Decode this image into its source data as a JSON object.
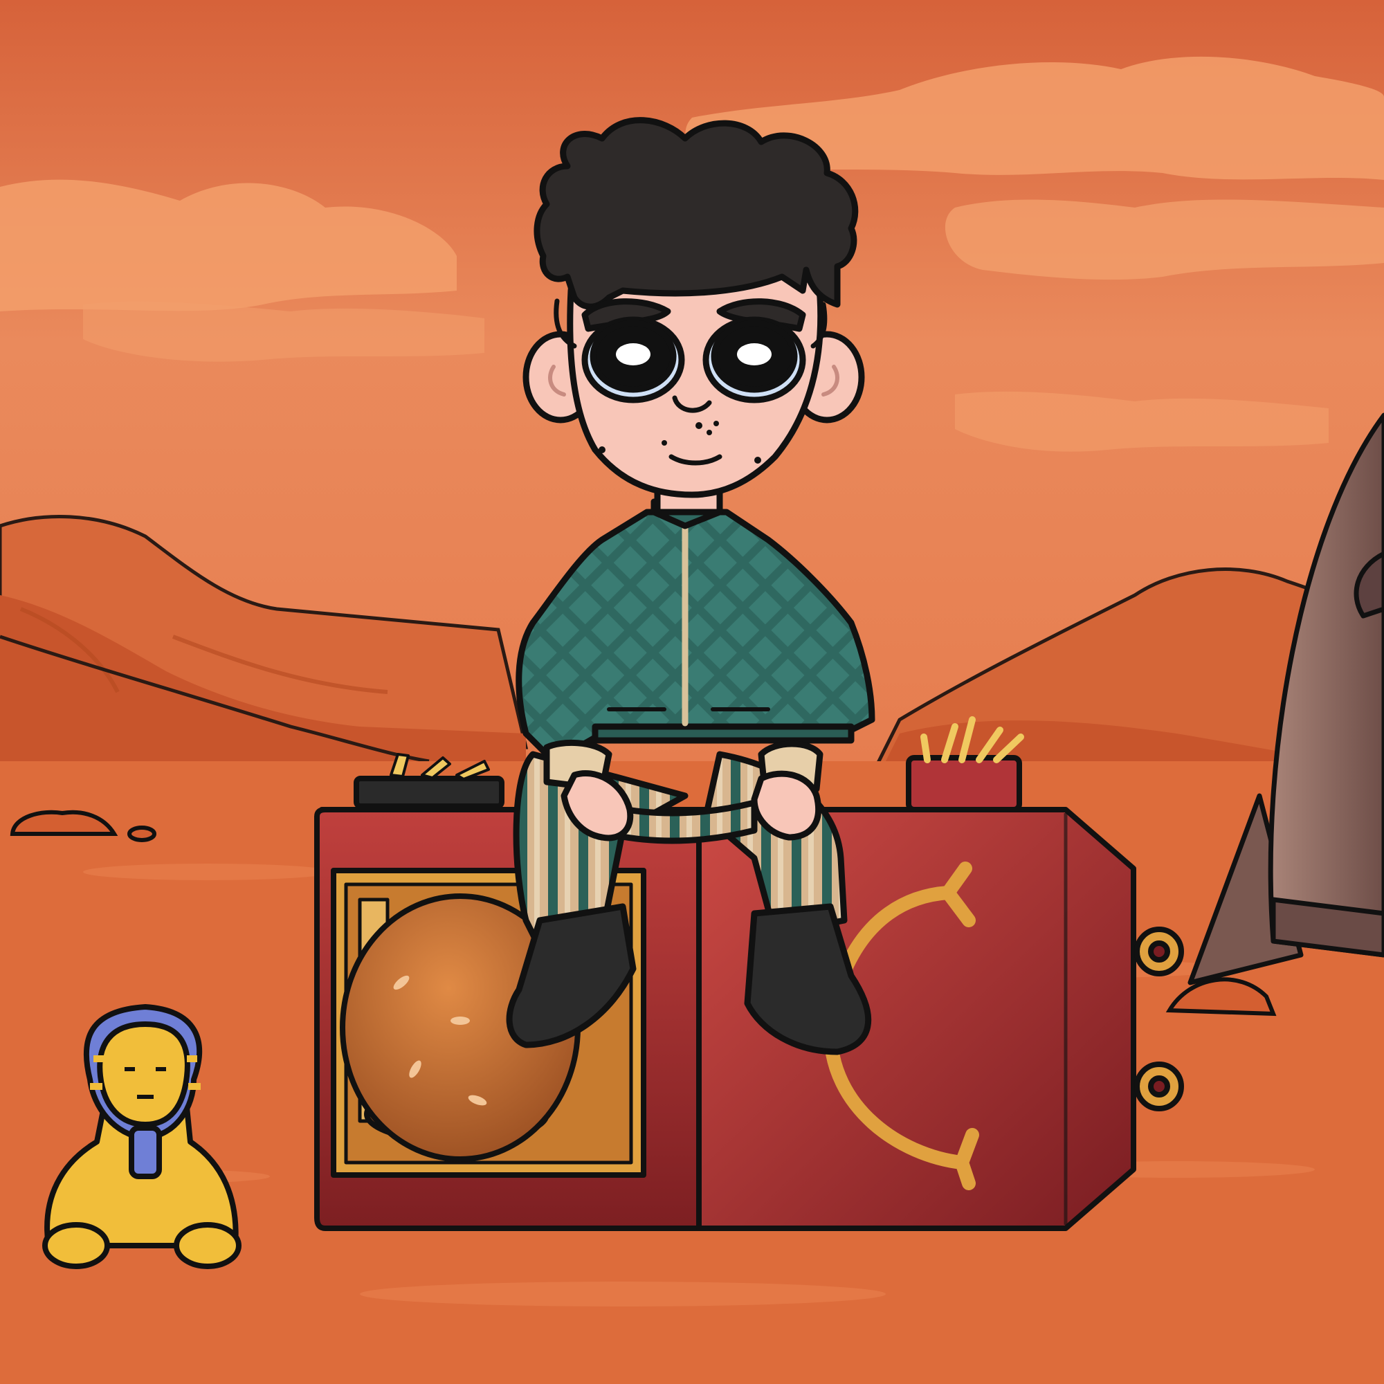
{
  "scene": {
    "setting": "mars-desert",
    "subject": "cartoon-boy-sitting-on-burger-meal-box",
    "props": [
      "burger",
      "fries",
      "arch-logo",
      "sphinx",
      "rocket"
    ]
  },
  "colors": {
    "sky_top": "#d9663a",
    "sky_mid": "#e8845a",
    "cloud": "#f4a06a",
    "hills": "#d2612f",
    "ground": "#dd6c3b",
    "outline": "#111111",
    "skin": "#f8c6b8",
    "hair": "#2e2a29",
    "jacket": "#2f6860",
    "stripe_light": "#d8b68f",
    "box_red": "#a82f2f",
    "logo_gold": "#e0a13f",
    "sphinx_gold": "#f1be3a",
    "sphinx_blue": "#6f7fd6",
    "rocket": "#8c6a60"
  }
}
